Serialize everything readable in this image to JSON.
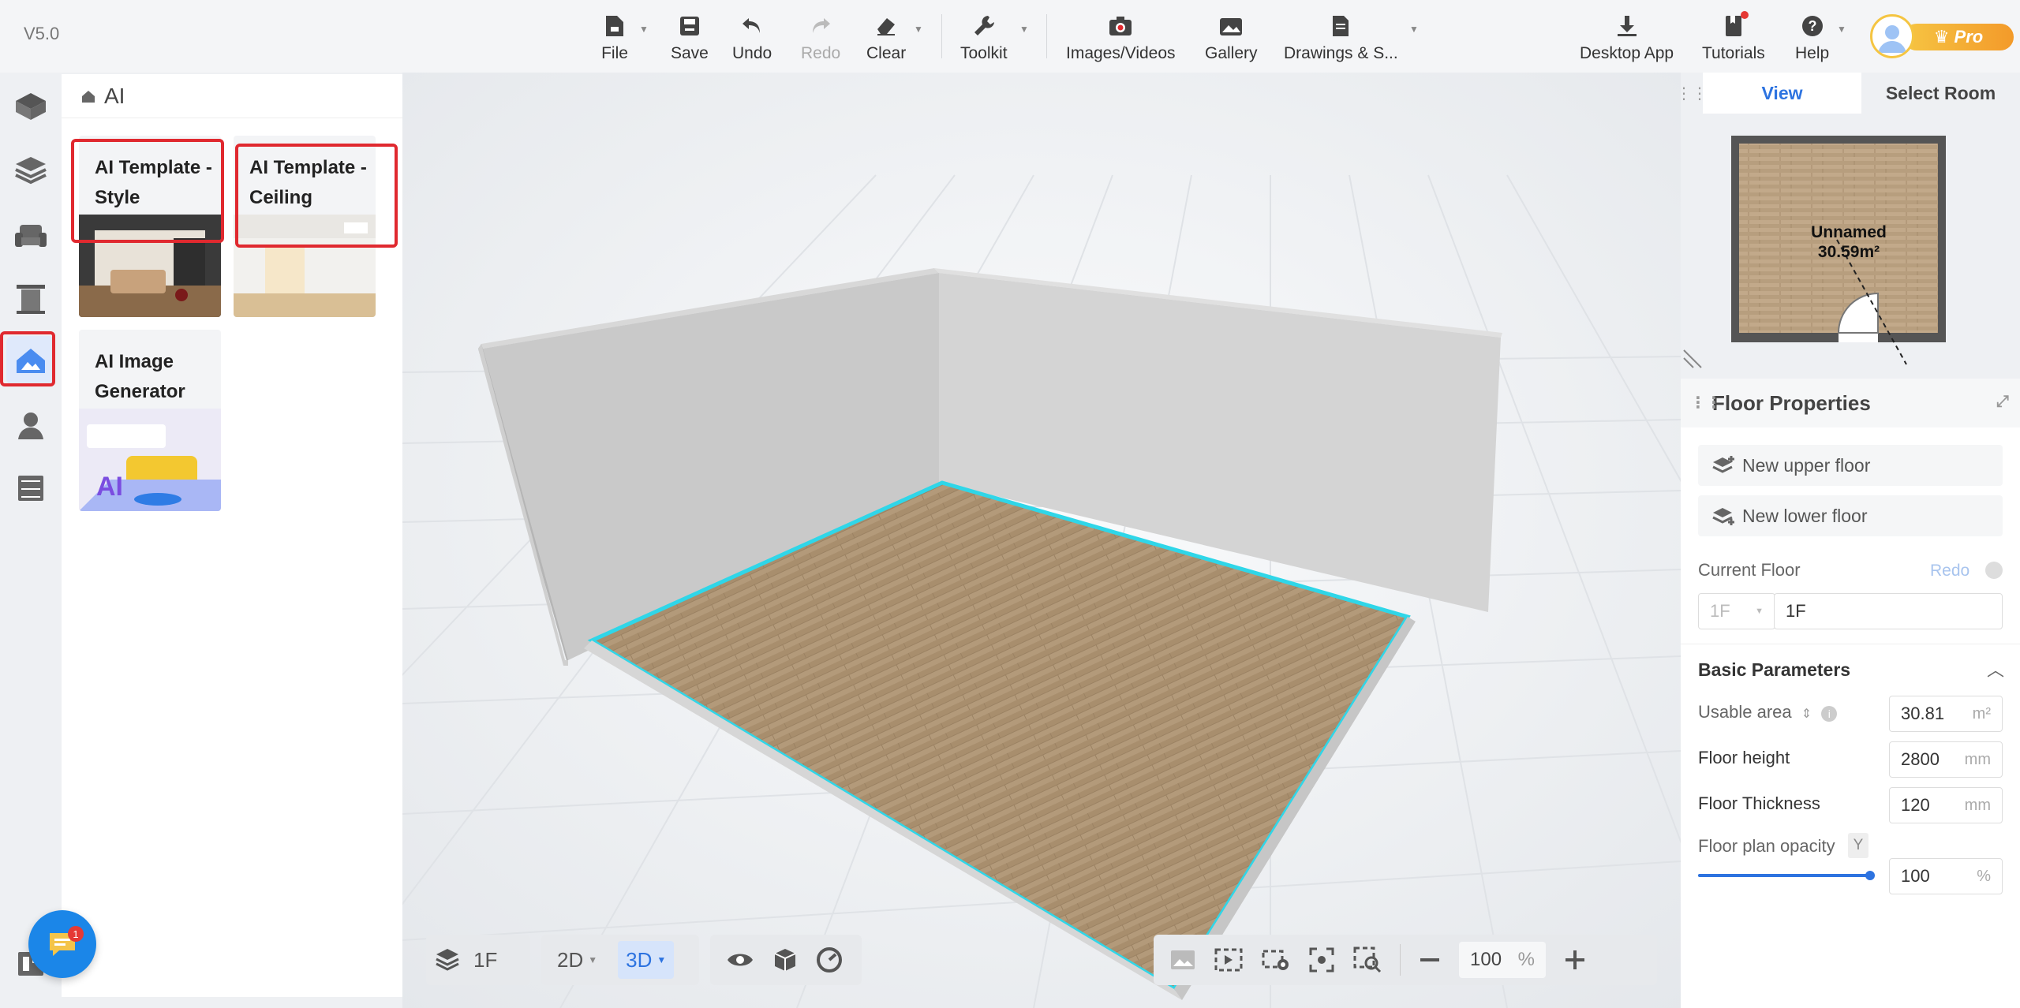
{
  "app": {
    "version": "V5.0"
  },
  "toolbar": {
    "file": "File",
    "save": "Save",
    "undo": "Undo",
    "redo": "Redo",
    "clear": "Clear",
    "toolkit": "Toolkit",
    "images_videos": "Images/Videos",
    "gallery": "Gallery",
    "drawings": "Drawings & S...",
    "desktop_app": "Desktop App",
    "tutorials": "Tutorials",
    "help": "Help",
    "pro_label": "Pro"
  },
  "catalog": {
    "title": "AI",
    "cards": [
      {
        "title": "AI Template - Style"
      },
      {
        "title": "AI Template - Ceiling"
      },
      {
        "title": "AI Image Generator"
      }
    ]
  },
  "viewport": {
    "floor_label": "1F",
    "mode_2d": "2D",
    "mode_3d": "3D",
    "zoom_value": "100",
    "zoom_unit": "%"
  },
  "chat": {
    "badge_count": "1"
  },
  "right_panel": {
    "tabs": [
      "View",
      "Select Room"
    ],
    "room_name": "Unnamed",
    "room_area": "30.59m²",
    "floor_properties": {
      "title": "Floor Properties",
      "new_upper_floor": "New upper floor",
      "new_lower_floor": "New lower floor",
      "current_floor_label": "Current Floor",
      "redo_label": "Redo",
      "current_floor_select": "1F",
      "current_floor_name": "1F",
      "basic_parameters": "Basic Parameters",
      "usable_area_label": "Usable area",
      "usable_area_value": "30.81",
      "usable_area_unit": "m²",
      "floor_height_label": "Floor height",
      "floor_height_value": "2800",
      "floor_height_unit": "mm",
      "floor_thickness_label": "Floor Thickness",
      "floor_thickness_value": "120",
      "floor_thickness_unit": "mm",
      "opacity_label": "Floor plan opacity",
      "opacity_key": "Y",
      "opacity_value": "100",
      "opacity_unit": "%",
      "opacity_level": 1.0
    }
  },
  "colors": {
    "accent": "#2d73e0",
    "highlight_box": "#e0292f",
    "floor_outline": "#2fd6e8"
  }
}
